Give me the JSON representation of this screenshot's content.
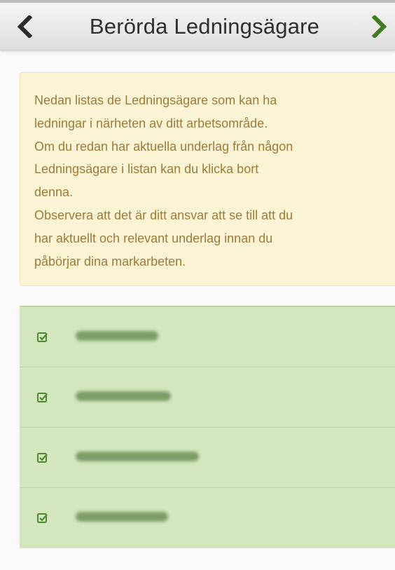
{
  "header": {
    "title": "Berörda Ledningsägare"
  },
  "info": {
    "lines": [
      "Nedan listas de Ledningsägare som kan ha",
      "ledningar i närheten av ditt arbetsområde.",
      "Om du redan har aktuella underlag från någon",
      "Ledningsägare i listan kan du klicka bort",
      "denna.",
      "Observera att det är ditt ansvar att se till att du",
      "har aktuellt och relevant underlag innan du",
      "påbörjar dina markarbeten."
    ]
  },
  "owners": {
    "items": [
      {
        "checked": true
      },
      {
        "checked": true
      },
      {
        "checked": true
      },
      {
        "checked": true
      }
    ]
  },
  "colors": {
    "info_bg": "#fbf4d4",
    "info_text": "#9c7a3a",
    "list_bg": "#d3e6bd",
    "check_green": "#4d8a2f",
    "forward_arrow": "#3f7d1f"
  }
}
